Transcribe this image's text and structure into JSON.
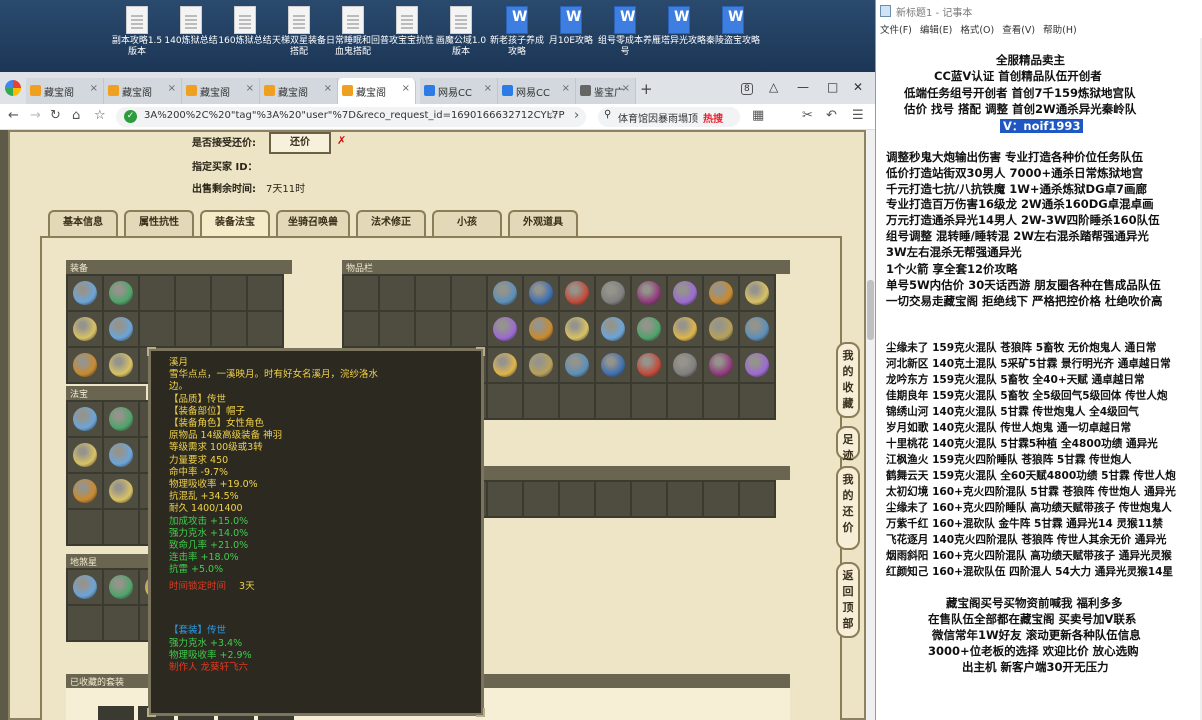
{
  "desktop": {
    "icons": [
      {
        "label": "副本攻略1.5版本",
        "kind": "doc"
      },
      {
        "label": "140炼狱总结",
        "kind": "doc"
      },
      {
        "label": "160炼狱总结",
        "kind": "doc"
      },
      {
        "label": "天梯双星装备搭配",
        "kind": "doc"
      },
      {
        "label": "日常睡眠和回血鬼搭配",
        "kind": "doc"
      },
      {
        "label": "普攻宝宝抗性",
        "kind": "doc"
      },
      {
        "label": "画魔公域1.0版本",
        "kind": "doc"
      },
      {
        "label": "新老孩子养成攻略",
        "kind": "wps"
      },
      {
        "label": "月10E攻略",
        "kind": "wps"
      },
      {
        "label": "组号零成本养号",
        "kind": "wps"
      },
      {
        "label": "雁塔异光攻略",
        "kind": "wps"
      },
      {
        "label": "秦陵盗宝攻略",
        "kind": "wps"
      }
    ]
  },
  "browser": {
    "tabs": [
      {
        "label": "藏宝阁",
        "fav_color": "#f0a020",
        "active": false
      },
      {
        "label": "藏宝阁",
        "fav_color": "#f0a020",
        "active": false
      },
      {
        "label": "藏宝阁",
        "fav_color": "#f0a020",
        "active": false
      },
      {
        "label": "藏宝阁",
        "fav_color": "#f0a020",
        "active": false
      },
      {
        "label": "藏宝阁",
        "fav_color": "#f0a020",
        "active": true
      },
      {
        "label": "网易CC",
        "fav_color": "#2d7be5",
        "active": false
      },
      {
        "label": "网易CC",
        "fav_color": "#2d7be5",
        "active": false
      },
      {
        "label": "鉴宝广",
        "fav_color": "#666666",
        "active": false
      }
    ],
    "tab_count": "8",
    "url": "3A%200%2C%20\"tag\"%3A%20\"user\"%7D&reco_request_id=1690166632712CYL7P",
    "search_text": "体育馆因暴雨塌顶",
    "hot_label": "热搜"
  },
  "listing": {
    "accept_counter_label": "是否接受还价:",
    "counter_button": "还价",
    "buyer_label": "指定买家 ID：",
    "time_label": "出售剩余时间:",
    "time_value": "7天11时"
  },
  "game_tabs": [
    "基本信息",
    "属性抗性",
    "装备法宝",
    "坐骑召唤兽",
    "法术修正",
    "小孩",
    "外观道具"
  ],
  "sections": {
    "equipment": "装备",
    "inventory": "物品栏",
    "fabao": "法宝",
    "dijianglingyan": "地煞星",
    "collected_sets": "已收藏的套装"
  },
  "tooltip": {
    "lines": [
      {
        "text": "溪月",
        "color": "#f2d24a"
      },
      {
        "text": "雪华点点，一溪映月。时有好女名溪月，浣纱洛水",
        "color": "#f2d24a"
      },
      {
        "text": "边。",
        "color": "#f2d24a"
      },
      {
        "text": "【品质】传世",
        "color": "#f2d24a"
      },
      {
        "text": "【装备部位】帽子",
        "color": "#f2d24a"
      },
      {
        "text": "【装备角色】女性角色",
        "color": "#f2d24a"
      },
      {
        "text": "原物品 14级高级装备 神羽",
        "color": "#f2d24a"
      },
      {
        "text": "等级需求 100级或3转",
        "color": "#f2d24a"
      },
      {
        "text": "力量要求 450",
        "color": "#f2d24a"
      },
      {
        "text": "命中率 -9.7%",
        "color": "#f2d24a"
      },
      {
        "text": "物理吸收率 +19.0%",
        "color": "#f2d24a"
      },
      {
        "text": "抗混乱 +34.5%",
        "color": "#f2d24a"
      },
      {
        "text": "耐久 1400/1400",
        "color": "#f2d24a"
      },
      {
        "text": "加成攻击 +15.0%",
        "color": "#3fce4c"
      },
      {
        "text": "强力克水 +14.0%",
        "color": "#3fce4c"
      },
      {
        "text": "致命几率 +21.0%",
        "color": "#3fce4c"
      },
      {
        "text": "连击率 +18.0%",
        "color": "#3fce4c"
      },
      {
        "text": "抗雷 +5.0%",
        "color": "#3fce4c"
      },
      {
        "text": "",
        "color": "#f2d24a"
      },
      {
        "text": "",
        "color": "#f2d24a"
      },
      {
        "text": "",
        "color": "#f2d24a"
      },
      {
        "text": "",
        "color": "#f2d24a"
      },
      {
        "text": "【套装】传世",
        "color": "#2d9ce8"
      },
      {
        "text": "强力克水 +3.4%",
        "color": "#3fce4c"
      },
      {
        "text": "物理吸收率 +2.9%",
        "color": "#3fce4c"
      },
      {
        "text": "制作人 龙葵轩飞六",
        "color": "#e23a1e"
      }
    ],
    "limit_label": "时间锁定时间",
    "limit_value": "3天"
  },
  "side_buttons": [
    "我的收藏",
    "足迹",
    "我的还价",
    "返回顶部"
  ],
  "notepad": {
    "title": "新标题1 - 记事本",
    "menu": [
      "文件(F)",
      "编辑(E)",
      "格式(O)",
      "查看(V)",
      "帮助(H)"
    ],
    "lines": [
      {
        "text": "全服精品卖主",
        "hl": false
      },
      {
        "text": "CC蓝V认证  首创精品队伍开创者",
        "hl": false
      },
      {
        "text": "低端任务组号开创者          首创7千159炼狱地宫队",
        "hl": false
      },
      {
        "text": "估价 找号 搭配 调整          首创2W通杀异光秦岭队",
        "hl": false
      },
      {
        "text": "V：noif1993",
        "hl": true
      },
      {
        "text": "调整秒鬼大炮输出伤害        专业打造各种价位任务队伍",
        "hl": false
      },
      {
        "text": "低价打造站街双30男人          7000+通杀日常炼狱地宫",
        "hl": false
      },
      {
        "text": "千元打造七抗/八抗铁魔        1W+通杀炼狱DG卓7画廊",
        "hl": false
      },
      {
        "text": "专业打造百万伤害16级龙        2W通杀160DG卓混卓画",
        "hl": false
      },
      {
        "text": "万元打造通杀异光14男人      2W-3W四阶睡杀160队伍",
        "hl": false
      },
      {
        "text": "组号调整 混转睡/睡转混        2W左右混杀踏帮强通异光",
        "hl": false
      },
      {
        "text": "                                         3W左右混杀无帮强通异光",
        "hl": false
      },
      {
        "text": "1个火箭 享全套12价攻略",
        "hl": false
      },
      {
        "text": "单号5W内估价 30天话西游        朋友圈各种在售成品队伍",
        "hl": false
      },
      {
        "text": "一切交易走藏宝阁 拒绝线下      严格把控价格 杜绝吹价高",
        "hl": false
      },
      {
        "text": "尘缘未了 159克火混队 苍狼阵 5畜牧 无价炮鬼人 通日常",
        "hl": false
      },
      {
        "text": "河北新区 140克土混队 5采矿5甘霖 景行明光齐 通卓越日常",
        "hl": false
      },
      {
        "text": "龙吟东方 159克火混队 5畜牧 全40+天赋 通卓越日常",
        "hl": false
      },
      {
        "text": "佳期良年 159克火混队 5畜牧 全5级回气5级回体 传世人炮",
        "hl": false
      },
      {
        "text": "锦绣山河 140克火混队 5甘霖 传世炮鬼人 全4级回气",
        "hl": false
      },
      {
        "text": "岁月如歌 140克火混队 传世人炮鬼 通一切卓越日常",
        "hl": false
      },
      {
        "text": "十里桃花 140克火混队 5甘霖5种植 全4800功绩 通异光",
        "hl": false
      },
      {
        "text": "江枫渔火 159克火四阶睡队 苍狼阵 5甘霖 传世炮人",
        "hl": false
      },
      {
        "text": "鹤舞云天 159克火混队 全60天赋4800功绩 5甘霖 传世人炮",
        "hl": false
      },
      {
        "text": "太初幻境 160+克火四阶混队 5甘霖 苍狼阵 传世炮人 通异光",
        "hl": false
      },
      {
        "text": "尘缘未了 160+克火四阶睡队 高功绩天赋带孩子 传世炮鬼人",
        "hl": false
      },
      {
        "text": "万紫千红 160+混砍队 金牛阵 5甘霖 通异光14 灵猴11禁",
        "hl": false
      },
      {
        "text": "飞花逐月 140克火四阶混队 苍狼阵 传世人其余无价 通异光",
        "hl": false
      },
      {
        "text": "烟雨斜阳 160+克火四阶混队 高功绩天赋带孩子 通异光灵猴",
        "hl": false
      },
      {
        "text": "红颜知己 160+混砍队伍 四阶混人 54大力 通异光灵猴14星",
        "hl": false
      },
      {
        "text": "藏宝阁买号买物资前喊我 福利多多",
        "hl": false
      },
      {
        "text": "在售队伍全部都在藏宝阁 买卖号加V联系",
        "hl": false
      },
      {
        "text": "微信常年1W好友 滚动更新各种队伍信息",
        "hl": false
      },
      {
        "text": "3000+位老板的选择 欢迎比价 放心选购",
        "hl": false
      },
      {
        "text": "出主机 新客户端30开无压力",
        "hl": false
      }
    ]
  },
  "colors": {
    "page_bg": "#ede3c5",
    "panel_border": "#8a7d57",
    "tooltip_bg": "#2b2920",
    "highlight": "#1f57c3"
  }
}
